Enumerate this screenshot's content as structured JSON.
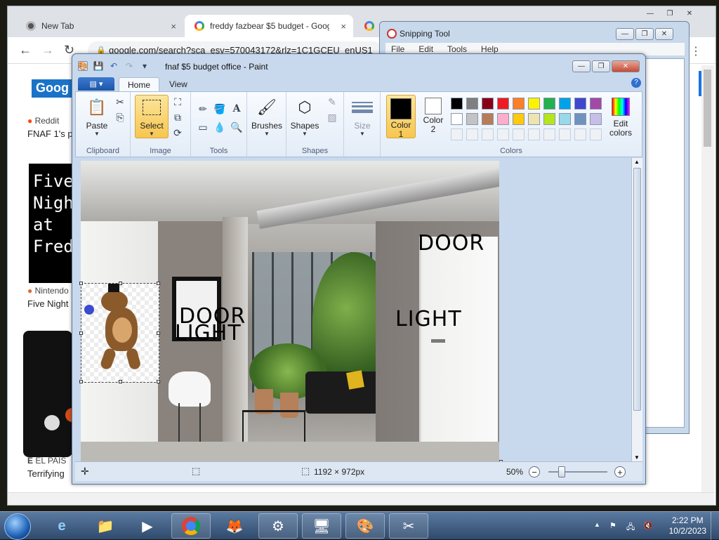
{
  "browser": {
    "tabs": [
      {
        "title": "New Tab",
        "close": "×"
      },
      {
        "title": "freddy fazbear $5 budget - Goog",
        "close": "×"
      },
      {
        "title": "G"
      }
    ],
    "url": "google.com/search?sca_esv=570043172&rlz=1C1GCEU_enUS1",
    "nav": {
      "back": "←",
      "forward": "→",
      "reload": "↻",
      "menu": "⋮"
    },
    "results": {
      "logo": "Goog",
      "r1_source": "Reddit",
      "r1_title": "FNAF 1's p",
      "thumb1_text": [
        "Five",
        "Nigh",
        "at",
        "Fred"
      ],
      "r2_source": "Nintendo",
      "r2_title": "Five Night",
      "r3_source": "EL PAÍS",
      "r3_title": "Terrifying"
    }
  },
  "snipping": {
    "title": "Snipping Tool",
    "menu": [
      "File",
      "Edit",
      "Tools",
      "Help"
    ]
  },
  "paint": {
    "title": "fnaf $5 budget office - Paint",
    "tabs": {
      "home": "Home",
      "view": "View"
    },
    "groups": {
      "clipboard": "Clipboard",
      "image": "Image",
      "tools": "Tools",
      "shapes": "Shapes",
      "colors": "Colors"
    },
    "buttons": {
      "paste": "Paste",
      "select": "Select",
      "brushes": "Brushes",
      "shapes": "Shapes",
      "size": "Size",
      "color1": [
        "Color",
        "1"
      ],
      "color2": [
        "Color",
        "2"
      ],
      "edit_colors": [
        "Edit",
        "colors"
      ]
    },
    "palette_row1": [
      "#000000",
      "#7f7f7f",
      "#880015",
      "#ed1c24",
      "#ff7f27",
      "#fff200",
      "#22b14c",
      "#00a2e8",
      "#3f48cc",
      "#a349a4"
    ],
    "palette_row2": [
      "#ffffff",
      "#c3c3c3",
      "#b97a57",
      "#ffaec9",
      "#ffc90e",
      "#efe4b0",
      "#b5e61d",
      "#99d9ea",
      "#7092be",
      "#c8bfe7"
    ],
    "canvas_text": {
      "door_left": "DOOR",
      "light_left": "LIGHT",
      "door_right": "DOOR",
      "light_right": "LIGHT"
    },
    "status": {
      "dimensions": "1192 × 972px",
      "zoom": "50%"
    }
  },
  "taskbar": {
    "time": "2:22 PM",
    "date": "10/2/2023"
  }
}
